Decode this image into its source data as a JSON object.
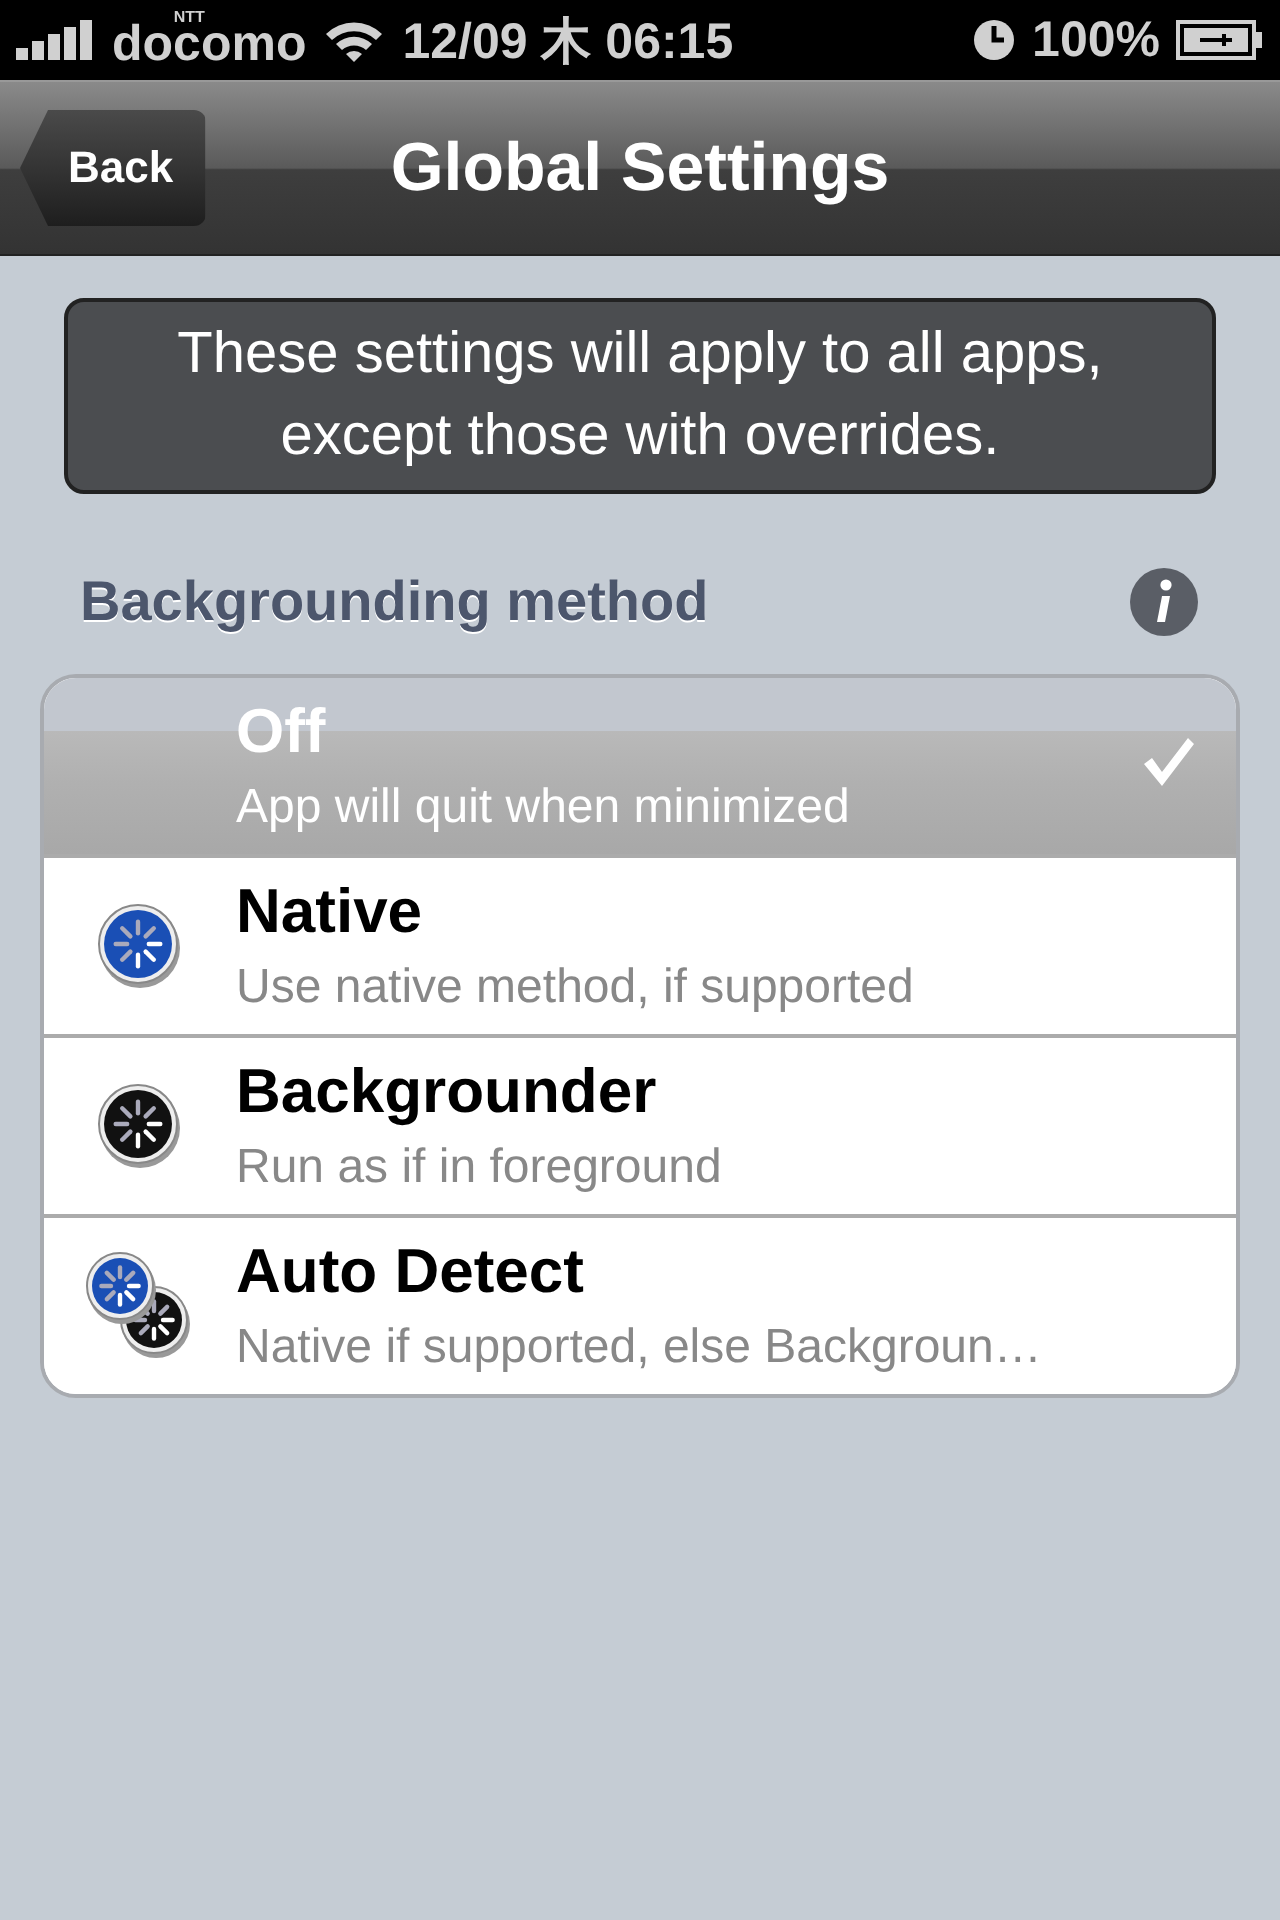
{
  "status_bar": {
    "carrier_prefix": "NTT",
    "carrier": "docomo",
    "time": "12/09 木 06:15",
    "battery": "100%"
  },
  "nav_bar": {
    "back": "Back",
    "title": "Global Settings"
  },
  "notice": "These settings will apply to all apps, except those with overrides.",
  "section": {
    "title": "Backgrounding method"
  },
  "options": [
    {
      "title": "Off",
      "subtitle": "App will quit when minimized",
      "selected": true
    },
    {
      "title": "Native",
      "subtitle": "Use native method, if supported",
      "selected": false,
      "kind": "native"
    },
    {
      "title": "Backgrounder",
      "subtitle": "Run as if in foreground",
      "selected": false,
      "kind": "backgrounder"
    },
    {
      "title": "Auto Detect",
      "subtitle": "Native if supported, else Backgroun…",
      "selected": false,
      "kind": "auto"
    }
  ]
}
